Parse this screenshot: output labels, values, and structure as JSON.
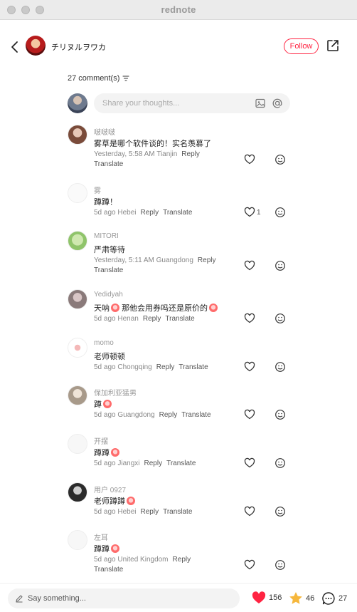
{
  "window": {
    "title": "rednote"
  },
  "header": {
    "author_name": "チリヌルヲワカ",
    "follow_label": "Follow"
  },
  "comments_header": {
    "count_label": "27 comment(s)"
  },
  "composer": {
    "placeholder": "Share your thoughts..."
  },
  "labels": {
    "reply": "Reply",
    "translate": "Translate"
  },
  "comments": [
    {
      "user": "啵啵啵",
      "text": "雾草是哪个软件谈的！实名羡慕了",
      "meta": "Yesterday, 5:58 AM Tianjin",
      "reply": "Reply",
      "translate": "Translate"
    },
    {
      "user": "雾",
      "text": "蹲蹲！",
      "meta": "5d ago Hebei",
      "reply": "Reply",
      "translate": "Translate",
      "likes": "1"
    },
    {
      "user": "MITORI",
      "text": "严肃等待",
      "meta": "Yesterday, 5:11 AM Guangdong",
      "reply": "Reply",
      "translate": "Translate"
    },
    {
      "user": "Yedidyah",
      "text_a": "天呐",
      "text_b": "那他会用券吗还是原价的",
      "meta": "5d ago Henan",
      "reply": "Reply",
      "translate": "Translate"
    },
    {
      "user": "momo",
      "text": "老师顿顿",
      "meta": "5d ago Chongqing",
      "reply": "Reply",
      "translate": "Translate"
    },
    {
      "user": "保加利亚猛男",
      "text": "蹲",
      "meta": "5d ago Guangdong",
      "reply": "Reply",
      "translate": "Translate"
    },
    {
      "user": "开摆",
      "text": "蹲蹲",
      "meta": "5d ago Jiangxi",
      "reply": "Reply",
      "translate": "Translate"
    },
    {
      "user": "用户 0927",
      "text": "老师蹲蹲",
      "meta": "5d ago Hebei",
      "reply": "Reply",
      "translate": "Translate"
    },
    {
      "user": "左耳",
      "text": "蹲蹲",
      "meta": "5d ago United Kingdom",
      "reply": "Reply",
      "translate": "Translate"
    }
  ],
  "bottom_bar": {
    "say_placeholder": "Say something...",
    "likes": "156",
    "stars": "46",
    "comments": "27"
  },
  "colors": {
    "accent": "#ff2442"
  }
}
